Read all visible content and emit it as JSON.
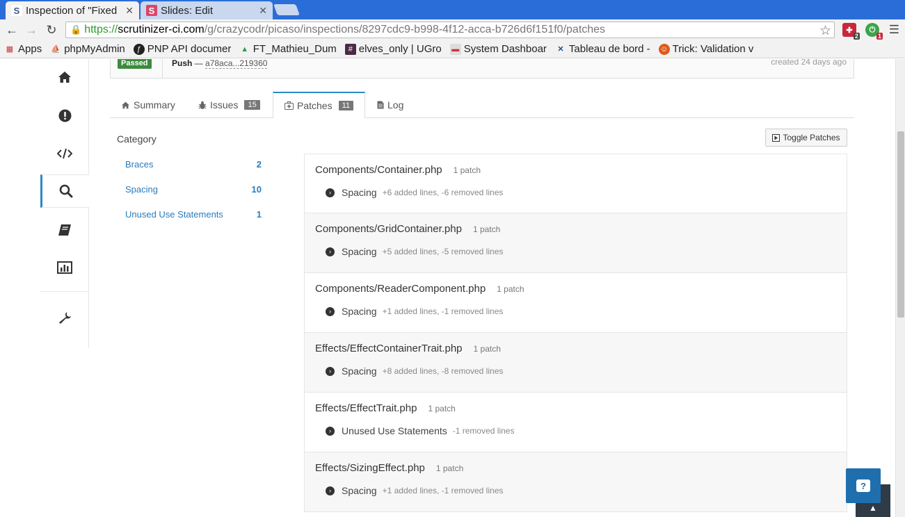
{
  "browser": {
    "tabs": [
      {
        "title": "Inspection of \"Fixed",
        "favicon": "S",
        "active": true
      },
      {
        "title": "Slides: Edit",
        "favicon": "S",
        "active": false
      }
    ],
    "url": {
      "scheme": "https://",
      "host": "scrutinizer-ci.com",
      "path": "/g/crazycodr/picaso/inspections/8297cdc9-b998-4f12-acca-b726d6f151f0/patches"
    },
    "extensions": [
      {
        "name": "puzzle-extension-icon",
        "badge": "2",
        "color": "#c8283a"
      },
      {
        "name": "power-extension-icon",
        "badge": "1",
        "color": "#3aa54a"
      }
    ],
    "bookmarks": [
      {
        "label": "Apps",
        "icon": "apps-grid-icon"
      },
      {
        "label": "phpMyAdmin",
        "icon": "phpmyadmin-icon"
      },
      {
        "label": "PNP API documer",
        "icon": "symfony-icon"
      },
      {
        "label": "FT_Mathieu_Dum",
        "icon": "drive-icon"
      },
      {
        "label": "elves_only | UGro",
        "icon": "hash-icon"
      },
      {
        "label": "System Dashboar",
        "icon": "dashboard-icon"
      },
      {
        "label": "Tableau de bord -",
        "icon": "x-logo-icon"
      },
      {
        "label": "Trick: Validation v",
        "icon": "trick-icon"
      }
    ]
  },
  "header": {
    "status": "Passed",
    "push_label": "Push",
    "push_sep": " — ",
    "hash": "a78aca...219360",
    "created": "created 24 days ago"
  },
  "tabs": [
    {
      "label": "Summary",
      "icon": "home-icon"
    },
    {
      "label": "Issues",
      "icon": "bug-icon",
      "count": "15"
    },
    {
      "label": "Patches",
      "icon": "medkit-icon",
      "count": "11"
    },
    {
      "label": "Log",
      "icon": "file-icon"
    }
  ],
  "category": {
    "title": "Category",
    "items": [
      {
        "label": "Braces",
        "count": "2"
      },
      {
        "label": "Spacing",
        "count": "10"
      },
      {
        "label": "Unused Use Statements",
        "count": "1"
      }
    ]
  },
  "toggle_label": "Toggle Patches",
  "patches": [
    {
      "file": "Components/Container.php",
      "count": "1 patch",
      "type": "Spacing",
      "stats": "+6 added lines, -6 removed lines"
    },
    {
      "file": "Components/GridContainer.php",
      "count": "1 patch",
      "type": "Spacing",
      "stats": "+5 added lines, -5 removed lines"
    },
    {
      "file": "Components/ReaderComponent.php",
      "count": "1 patch",
      "type": "Spacing",
      "stats": "+1 added lines, -1 removed lines"
    },
    {
      "file": "Effects/EffectContainerTrait.php",
      "count": "1 patch",
      "type": "Spacing",
      "stats": "+8 added lines, -8 removed lines"
    },
    {
      "file": "Effects/EffectTrait.php",
      "count": "1 patch",
      "type": "Unused Use Statements",
      "stats": "-1 removed lines"
    },
    {
      "file": "Effects/SizingEffect.php",
      "count": "1 patch",
      "type": "Spacing",
      "stats": "+1 added lines, -1 removed lines"
    }
  ],
  "help_label": "?",
  "colors": {
    "accent": "#2b88c6",
    "passed": "#3c8b3c",
    "link": "#2b7bb9",
    "browser_blue": "#2b6dd8"
  }
}
